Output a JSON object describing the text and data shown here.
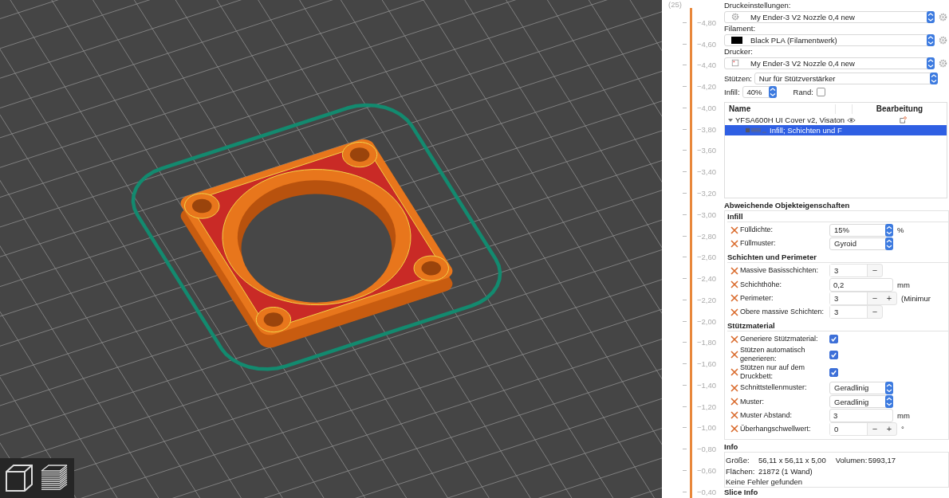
{
  "layer_slider": {
    "layer_count": "(25)",
    "ticks": [
      "−4,80",
      "−4,60",
      "−4,40",
      "−4,20",
      "−4,00",
      "−3,80",
      "−3,60",
      "−3,40",
      "−3,20",
      "−3,00",
      "−2,80",
      "−2,60",
      "−2,40",
      "−2,20",
      "−2,00",
      "−1,80",
      "−1,60",
      "−1,40",
      "−1,20",
      "−1,00",
      "−0,80",
      "−0,60",
      "−0,40"
    ]
  },
  "presets": [
    {
      "kind": "print",
      "label": "Druckeinstellungen:",
      "value": "My Ender-3 V2 Nozzle 0,4 new"
    },
    {
      "kind": "filament",
      "label": "Filament:",
      "value": "Black PLA (Filamentwerk)",
      "color": "#000000"
    },
    {
      "kind": "printer",
      "label": "Drucker:",
      "value": "My Ender-3 V2 Nozzle 0,4 new"
    }
  ],
  "supports": {
    "label": "Stützen:",
    "value": "Nur für Stützverstärker"
  },
  "infill": {
    "label": "Infill:",
    "value": "40%"
  },
  "brim": {
    "label": "Rand:",
    "checked": false
  },
  "object_list": {
    "columns": [
      "Name",
      "Bearbeitung"
    ],
    "items": [
      {
        "name": "YFSA600H UI Cover v2, Visaton",
        "expanded": true,
        "selected": false,
        "children": [
          {
            "name": "Infill; Schichten und F",
            "selected": true
          }
        ]
      }
    ]
  },
  "overrides": {
    "title": "Abweichende Objekteigenschaften",
    "groups": [
      {
        "title": "Infill",
        "settings": [
          {
            "kind": "combo",
            "label": "Fülldichte:",
            "value": "15%",
            "unit": "%"
          },
          {
            "kind": "combo",
            "label": "Füllmuster:",
            "value": "Gyroid"
          }
        ]
      },
      {
        "title": "Schichten und Perimeter",
        "settings": [
          {
            "kind": "spin",
            "label": "Massive Basisschichten:",
            "value": "3",
            "buttons": [
              "−"
            ]
          },
          {
            "kind": "text",
            "label": "Schichthöhe:",
            "value": "0,2",
            "unit": "mm"
          },
          {
            "kind": "spin",
            "label": "Perimeter:",
            "value": "3",
            "buttons": [
              "−",
              "+"
            ],
            "unit": "(Minimur"
          },
          {
            "kind": "spin",
            "label": "Obere massive Schichten:",
            "value": "3",
            "buttons": [
              "−"
            ]
          }
        ]
      },
      {
        "title": "Stützmaterial",
        "settings": [
          {
            "kind": "check",
            "label": "Generiere Stützmaterial:",
            "checked": true
          },
          {
            "kind": "check",
            "label": "Stützen automatisch generieren:",
            "checked": true
          },
          {
            "kind": "check",
            "label": "Stützen nur auf dem Druckbett:",
            "checked": true
          },
          {
            "kind": "combo",
            "label": "Schnittstellenmuster:",
            "value": "Geradlinig"
          },
          {
            "kind": "combo",
            "label": "Muster:",
            "value": "Geradlinig"
          },
          {
            "kind": "text",
            "label": "Muster Abstand:",
            "value": "3",
            "unit": "mm"
          },
          {
            "kind": "spin",
            "label": "Überhangschwellwert:",
            "value": "0",
            "buttons": [
              "−",
              "+"
            ],
            "unit": "°"
          }
        ]
      }
    ]
  },
  "info": {
    "title": "Info",
    "rows": [
      [
        {
          "label": "Größe:",
          "value": "56,11 x 56,11 x 5,00"
        },
        {
          "label": "Volumen:",
          "value": "5993,17"
        }
      ],
      [
        {
          "label": "Flächen:",
          "value": "21872 (1 Wand)"
        }
      ]
    ],
    "message": "Keine Fehler gefunden"
  },
  "slice_info": {
    "title": "Slice Info"
  }
}
